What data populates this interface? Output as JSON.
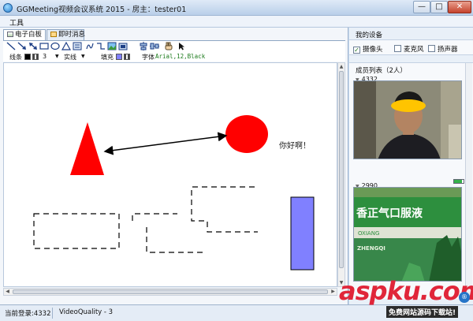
{
  "window": {
    "title": "GGMeeting视频会议系统 2015 - 房主：tester01",
    "min_glyph": "—",
    "max_glyph": "□",
    "close_glyph": "✕"
  },
  "menu": {
    "tools": "工具"
  },
  "tabs": [
    {
      "label": "电子白板",
      "active": true
    },
    {
      "label": "即时消息",
      "active": false
    }
  ],
  "toolbar": {
    "icons": [
      "line-icon",
      "arrow-icon",
      "double-arrow-icon",
      "rectangle-icon",
      "ellipse-icon",
      "triangle-icon",
      "image-tool-icon",
      "freehand-icon",
      "elbow-line-icon",
      "picture-icon",
      "screenshot-icon",
      "align-icon",
      "distribute-icon",
      "hand-icon",
      "cursor-icon"
    ]
  },
  "properties": {
    "line_label": "线条",
    "line_color": "#000000",
    "line_width": "3",
    "line_style": "实线",
    "fill_label": "填充",
    "fill_color": "#8080ff",
    "font_label": "字体",
    "font_value": "Arial,12,Black"
  },
  "whiteboard": {
    "text_annotation": "你好啊！",
    "triangle_color": "#ff0000",
    "circle_color": "#ff0000",
    "rect_fill": "#8080ff"
  },
  "devices": {
    "title": "我的设备",
    "items": [
      {
        "label": "摄像头",
        "checked": true
      },
      {
        "label": "麦克风",
        "checked": false
      },
      {
        "label": "扬声器",
        "checked": false
      }
    ]
  },
  "members": {
    "title": "成员列表（2人）",
    "list": [
      {
        "id": "4332"
      },
      {
        "id": "2990"
      }
    ],
    "audio_level": 0.8
  },
  "video2_sign": {
    "line1": "香正气口服液",
    "line2": "OXIANG",
    "line3": "ZHENGQI"
  },
  "status": {
    "current_login": "当前登录:4332",
    "video_quality": "VideoQuality - 3"
  },
  "watermark": {
    "main": "aspku.com",
    "sub": "免费网站源码下载站!",
    "badge": "®"
  }
}
